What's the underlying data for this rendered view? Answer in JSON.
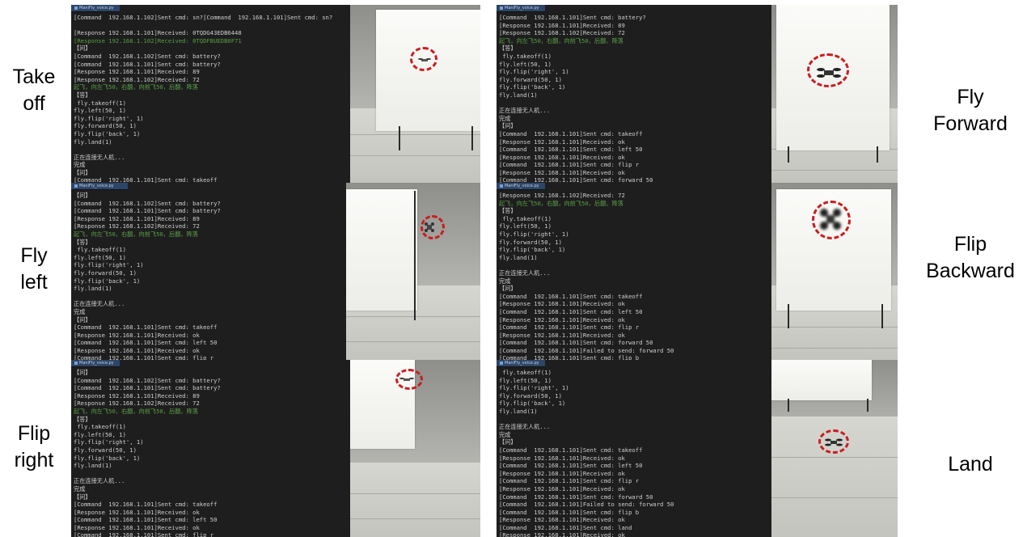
{
  "labels": {
    "take_off": [
      "Take",
      "off"
    ],
    "fly_left": [
      "Fly",
      "left"
    ],
    "flip_right": [
      "Flip",
      "right"
    ],
    "fly_forward": [
      "Fly",
      "Forward"
    ],
    "flip_backward": [
      "Flip",
      "Backward"
    ],
    "land": [
      "Land"
    ]
  },
  "window_title": "ManiFly_voice.py",
  "panels": {
    "take_off": [
      [
        "[Command  192.168.1.102]Sent cmd: sn?[Command  192.168.1.101]Sent cmd: sn?",
        ""
      ],
      [
        "",
        ""
      ],
      [
        "[Response 192.168.1.101]Received: 0TQDG43EDB6448",
        ""
      ],
      [
        "[Response 192.168.1.102]Received: 0TQDFBUEDB0F71",
        "green"
      ],
      [
        "【问】",
        ""
      ],
      [
        "[Command  192.168.1.102]Sent cmd: battery?",
        ""
      ],
      [
        "[Command  192.168.1.101]Sent cmd: battery?",
        ""
      ],
      [
        "[Response 192.168.1.101]Received: 89",
        ""
      ],
      [
        "[Response 192.168.1.102]Received: 72",
        ""
      ],
      [
        "起飞，向左飞50，右翻，向前飞50，后翻，降落",
        "green"
      ],
      [
        "【答】",
        ""
      ],
      [
        " fly.takeoff(1)",
        ""
      ],
      [
        "fly.left(50, 1)",
        ""
      ],
      [
        "fly.flip('right', 1)",
        ""
      ],
      [
        "fly.forward(50, 1)",
        ""
      ],
      [
        "fly.flip('back', 1)",
        ""
      ],
      [
        "fly.land(1)",
        ""
      ],
      [
        "",
        ""
      ],
      [
        "正在连接无人机...",
        ""
      ],
      [
        "完成",
        ""
      ],
      [
        "【问】",
        ""
      ],
      [
        "[Command  192.168.1.101]Sent cmd: takeoff",
        ""
      ]
    ],
    "fly_left": [
      [
        "【问】",
        ""
      ],
      [
        "[Command  192.168.1.102]Sent cmd: battery?",
        ""
      ],
      [
        "[Command  192.168.1.101]Sent cmd: battery?",
        ""
      ],
      [
        "[Response 192.168.1.101]Received: 89",
        ""
      ],
      [
        "[Response 192.168.1.102]Received: 72",
        ""
      ],
      [
        "起飞，向左飞50，右翻，向前飞50，后翻，降落",
        "green"
      ],
      [
        "【答】",
        ""
      ],
      [
        " fly.takeoff(1)",
        ""
      ],
      [
        "fly.left(50, 1)",
        ""
      ],
      [
        "fly.flip('right', 1)",
        ""
      ],
      [
        "fly.forward(50, 1)",
        ""
      ],
      [
        "fly.flip('back', 1)",
        ""
      ],
      [
        "fly.land(1)",
        ""
      ],
      [
        "",
        ""
      ],
      [
        "正在连接无人机...",
        ""
      ],
      [
        "完成",
        ""
      ],
      [
        "【问】",
        ""
      ],
      [
        "[Command  192.168.1.101]Sent cmd: takeoff",
        ""
      ],
      [
        "[Response 192.168.1.101]Received: ok",
        ""
      ],
      [
        "[Command  192.168.1.101]Sent cmd: left 50",
        ""
      ],
      [
        "[Response 192.168.1.101]Received: ok",
        ""
      ],
      [
        "[Command  192.168.1.101]Sent cmd: flip r",
        ""
      ]
    ],
    "flip_right": [
      [
        "【问】",
        ""
      ],
      [
        "[Command  192.168.1.102]Sent cmd: battery?",
        ""
      ],
      [
        "[Command  192.168.1.101]Sent cmd: battery?",
        ""
      ],
      [
        "[Response 192.168.1.101]Received: 89",
        ""
      ],
      [
        "[Response 192.168.1.102]Received: 72",
        ""
      ],
      [
        "起飞，向左飞50，右翻，向前飞50，后翻，降落",
        "green"
      ],
      [
        "【答】",
        ""
      ],
      [
        " fly.takeoff(1)",
        ""
      ],
      [
        "fly.left(50, 1)",
        ""
      ],
      [
        "fly.flip('right', 1)",
        ""
      ],
      [
        "fly.forward(50, 1)",
        ""
      ],
      [
        "fly.flip('back', 1)",
        ""
      ],
      [
        "fly.land(1)",
        ""
      ],
      [
        "",
        ""
      ],
      [
        "正在连接无人机...",
        ""
      ],
      [
        "完成",
        ""
      ],
      [
        "【问】",
        ""
      ],
      [
        "[Command  192.168.1.101]Sent cmd: takeoff",
        ""
      ],
      [
        "[Response 192.168.1.101]Received: ok",
        ""
      ],
      [
        "[Command  192.168.1.101]Sent cmd: left 50",
        ""
      ],
      [
        "[Response 192.168.1.101]Received: ok",
        ""
      ],
      [
        "[Command  192.168.1.101]Sent cmd: flip r",
        ""
      ]
    ],
    "fly_forward": [
      [
        "[Command  192.168.1.101]Sent cmd: battery?",
        ""
      ],
      [
        "[Response 192.168.1.101]Received: 89",
        ""
      ],
      [
        "[Response 192.168.1.102]Received: 72",
        ""
      ],
      [
        "起飞，向左飞50，右翻，向前飞50，后翻，降落",
        "green"
      ],
      [
        "【答】",
        ""
      ],
      [
        " fly.takeoff(1)",
        ""
      ],
      [
        "fly.left(50, 1)",
        ""
      ],
      [
        "fly.flip('right', 1)",
        ""
      ],
      [
        "fly.forward(50, 1)",
        ""
      ],
      [
        "fly.flip('back', 1)",
        ""
      ],
      [
        "fly.land(1)",
        ""
      ],
      [
        "",
        ""
      ],
      [
        "正在连接无人机...",
        ""
      ],
      [
        "完成",
        ""
      ],
      [
        "【问】",
        ""
      ],
      [
        "[Command  192.168.1.101]Sent cmd: takeoff",
        ""
      ],
      [
        "[Response 192.168.1.101]Received: ok",
        ""
      ],
      [
        "[Command  192.168.1.101]Sent cmd: left 50",
        ""
      ],
      [
        "[Response 192.168.1.101]Received: ok",
        ""
      ],
      [
        "[Command  192.168.1.101]Sent cmd: flip r",
        ""
      ],
      [
        "[Response 192.168.1.101]Received: ok",
        ""
      ],
      [
        "[Command  192.168.1.101]Sent cmd: forward 50",
        ""
      ]
    ],
    "flip_backward": [
      [
        "[Response 192.168.1.102]Received: 72",
        ""
      ],
      [
        "起飞，向左飞50，右翻，向前飞50，后翻，降落",
        "green"
      ],
      [
        "【答】",
        ""
      ],
      [
        " fly.takeoff(1)",
        ""
      ],
      [
        "fly.left(50, 1)",
        ""
      ],
      [
        "fly.flip('right', 1)",
        ""
      ],
      [
        "fly.forward(50, 1)",
        ""
      ],
      [
        "fly.flip('back', 1)",
        ""
      ],
      [
        "fly.land(1)",
        ""
      ],
      [
        "",
        ""
      ],
      [
        "正在连接无人机...",
        ""
      ],
      [
        "完成",
        ""
      ],
      [
        "【问】",
        ""
      ],
      [
        "[Command  192.168.1.101]Sent cmd: takeoff",
        ""
      ],
      [
        "[Response 192.168.1.101]Received: ok",
        ""
      ],
      [
        "[Command  192.168.1.101]Sent cmd: left 50",
        ""
      ],
      [
        "[Response 192.168.1.101]Received: ok",
        ""
      ],
      [
        "[Command  192.168.1.101]Sent cmd: flip r",
        ""
      ],
      [
        "[Response 192.168.1.101]Received: ok",
        ""
      ],
      [
        "[Command  192.168.1.101]Sent cmd: forward 50",
        ""
      ],
      [
        "[Command  192.168.1.101]Failed to send: forward 50",
        ""
      ],
      [
        "[Command  192.168.1.101]Sent cmd: flip b",
        ""
      ]
    ],
    "land": [
      [
        " fly.takeoff(1)",
        ""
      ],
      [
        "fly.left(50, 1)",
        ""
      ],
      [
        "fly.flip('right', 1)",
        ""
      ],
      [
        "fly.forward(50, 1)",
        ""
      ],
      [
        "fly.flip('back', 1)",
        ""
      ],
      [
        "fly.land(1)",
        ""
      ],
      [
        "",
        ""
      ],
      [
        "正在连接无人机...",
        ""
      ],
      [
        "完成",
        ""
      ],
      [
        "【问】",
        ""
      ],
      [
        "[Command  192.168.1.101]Sent cmd: takeoff",
        ""
      ],
      [
        "[Response 192.168.1.101]Received: ok",
        ""
      ],
      [
        "[Command  192.168.1.101]Sent cmd: left 50",
        ""
      ],
      [
        "[Response 192.168.1.101]Received: ok",
        ""
      ],
      [
        "[Command  192.168.1.101]Sent cmd: flip r",
        ""
      ],
      [
        "[Response 192.168.1.101]Received: ok",
        ""
      ],
      [
        "[Command  192.168.1.101]Sent cmd: forward 50",
        ""
      ],
      [
        "[Command  192.168.1.101]Failed to send: forward 50",
        ""
      ],
      [
        "[Command  192.168.1.101]Sent cmd: flip b",
        ""
      ],
      [
        "[Response 192.168.1.101]Received: ok",
        ""
      ],
      [
        "[Command  192.168.1.101]Sent cmd: land",
        ""
      ],
      [
        "[Response 192.168.1.101]Received: ok",
        ""
      ]
    ]
  },
  "colors": {
    "terminal_bg": "#1e1e1e",
    "terminal_text": "#cfcfcf",
    "terminal_green": "#5a9e45",
    "titlebar": "#2d4567",
    "highlight_circle": "#c81e1e"
  },
  "icons": [
    "drone-icon",
    "highlight-circle-icon"
  ]
}
